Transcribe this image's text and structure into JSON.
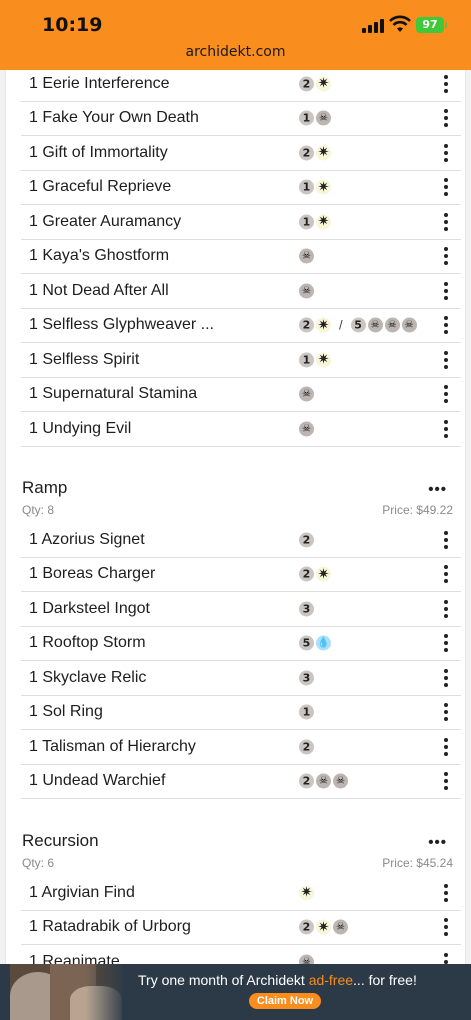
{
  "status_bar": {
    "time": "10:19",
    "battery": "97",
    "url": "archidekt.com"
  },
  "rows_top": [
    {
      "qty": "1",
      "name": "Eerie Interference",
      "cost": [
        {
          "t": "num",
          "v": "2"
        },
        {
          "t": "white",
          "v": "✷"
        }
      ]
    },
    {
      "qty": "1",
      "name": "Fake Your Own Death",
      "cost": [
        {
          "t": "num",
          "v": "1"
        },
        {
          "t": "black",
          "v": "☠"
        }
      ]
    },
    {
      "qty": "1",
      "name": "Gift of Immortality",
      "cost": [
        {
          "t": "num",
          "v": "2"
        },
        {
          "t": "white",
          "v": "✷"
        }
      ]
    },
    {
      "qty": "1",
      "name": "Graceful Reprieve",
      "cost": [
        {
          "t": "num",
          "v": "1"
        },
        {
          "t": "white",
          "v": "✷"
        }
      ]
    },
    {
      "qty": "1",
      "name": "Greater Auramancy",
      "cost": [
        {
          "t": "num",
          "v": "1"
        },
        {
          "t": "white",
          "v": "✷"
        }
      ]
    },
    {
      "qty": "1",
      "name": "Kaya's Ghostform",
      "cost": [
        {
          "t": "black",
          "v": "☠"
        }
      ]
    },
    {
      "qty": "1",
      "name": "Not Dead After All",
      "cost": [
        {
          "t": "black",
          "v": "☠"
        }
      ]
    },
    {
      "qty": "1",
      "name": "Selfless Glyphweaver ...",
      "cost": [
        {
          "t": "num",
          "v": "2"
        },
        {
          "t": "white",
          "v": "✷"
        },
        {
          "t": "slash",
          "v": "/"
        },
        {
          "t": "num",
          "v": "5"
        },
        {
          "t": "black",
          "v": "☠"
        },
        {
          "t": "black",
          "v": "☠"
        },
        {
          "t": "black",
          "v": "☠"
        }
      ]
    },
    {
      "qty": "1",
      "name": "Selfless Spirit",
      "cost": [
        {
          "t": "num",
          "v": "1"
        },
        {
          "t": "white",
          "v": "✷"
        }
      ]
    },
    {
      "qty": "1",
      "name": "Supernatural Stamina",
      "cost": [
        {
          "t": "black",
          "v": "☠"
        }
      ]
    },
    {
      "qty": "1",
      "name": "Undying Evil",
      "cost": [
        {
          "t": "black",
          "v": "☠"
        }
      ]
    }
  ],
  "ramp": {
    "title": "Ramp",
    "more": "•••",
    "qty": "Qty: 8",
    "price": "Price: $49.22",
    "rows": [
      {
        "qty": "1",
        "name": "Azorius Signet",
        "cost": [
          {
            "t": "num",
            "v": "2"
          }
        ]
      },
      {
        "qty": "1",
        "name": "Boreas Charger",
        "cost": [
          {
            "t": "num",
            "v": "2"
          },
          {
            "t": "white",
            "v": "✷"
          }
        ]
      },
      {
        "qty": "1",
        "name": "Darksteel Ingot",
        "cost": [
          {
            "t": "num",
            "v": "3"
          }
        ]
      },
      {
        "qty": "1",
        "name": "Rooftop Storm",
        "cost": [
          {
            "t": "num",
            "v": "5"
          },
          {
            "t": "blue",
            "v": "💧"
          }
        ]
      },
      {
        "qty": "1",
        "name": "Skyclave Relic",
        "cost": [
          {
            "t": "num",
            "v": "3"
          }
        ]
      },
      {
        "qty": "1",
        "name": "Sol Ring",
        "cost": [
          {
            "t": "num",
            "v": "1"
          }
        ]
      },
      {
        "qty": "1",
        "name": "Talisman of Hierarchy",
        "cost": [
          {
            "t": "num",
            "v": "2"
          }
        ]
      },
      {
        "qty": "1",
        "name": "Undead Warchief",
        "cost": [
          {
            "t": "num",
            "v": "2"
          },
          {
            "t": "black",
            "v": "☠"
          },
          {
            "t": "black",
            "v": "☠"
          }
        ]
      }
    ]
  },
  "recursion": {
    "title": "Recursion",
    "more": "•••",
    "qty": "Qty: 6",
    "price": "Price: $45.24",
    "rows": [
      {
        "qty": "1",
        "name": "Argivian Find",
        "cost": [
          {
            "t": "white",
            "v": "✷"
          }
        ]
      },
      {
        "qty": "1",
        "name": "Ratadrabik of Urborg",
        "cost": [
          {
            "t": "num",
            "v": "2"
          },
          {
            "t": "white",
            "v": "✷"
          },
          {
            "t": "black",
            "v": "☠"
          }
        ]
      },
      {
        "qty": "1",
        "name": "Reanimate",
        "cost": [
          {
            "t": "black",
            "v": "☠"
          }
        ]
      }
    ]
  },
  "ad": {
    "text_before": "Try one month of Archidekt ",
    "text_highlight": "ad-free",
    "text_after": "... for free!",
    "button": "Claim Now"
  },
  "colors": {
    "accent": "#f98d1d",
    "banner": "#2c3a47"
  }
}
